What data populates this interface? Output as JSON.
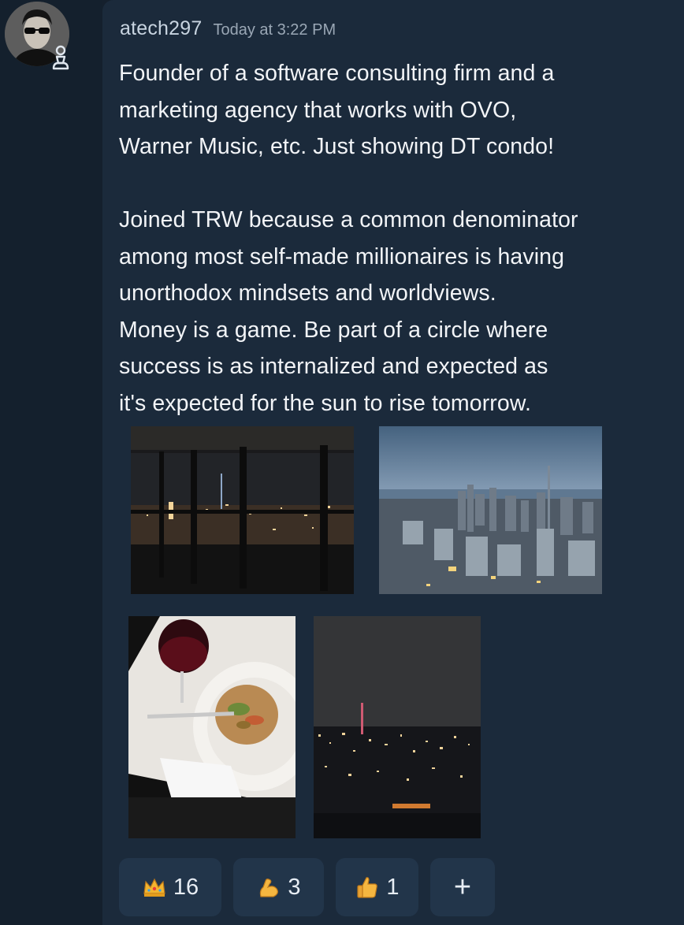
{
  "message": {
    "username": "atech297",
    "timestamp": "Today at 3:22 PM",
    "paragraphs": [
      [
        "Founder of a software consulting firm and a",
        "marketing agency that works with OVO,",
        "Warner Music, etc. Just showing DT condo!"
      ],
      [
        "Joined TRW because a common denominator",
        "among most self-made millionaires is having",
        "unorthodox mindsets and worldviews.",
        "Money is a game. Be part of a circle where",
        "success is as internalized and expected as",
        "it's expected for the sun to rise tomorrow."
      ]
    ]
  },
  "attachments": [
    {
      "name": "night-window-photo"
    },
    {
      "name": "city-skyline-photo"
    },
    {
      "name": "dinner-table-photo"
    },
    {
      "name": "night-tower-photo"
    }
  ],
  "reactions": [
    {
      "icon": "crown-icon",
      "count": "16"
    },
    {
      "icon": "flexed-biceps-icon",
      "count": "3"
    },
    {
      "icon": "thumbs-up-icon",
      "count": "1"
    }
  ],
  "add_reaction": {
    "label": "+"
  },
  "colors": {
    "background": "#15202d",
    "panel": "#1b2a3b",
    "reaction_chip": "#22354a",
    "username": "#c8d4e0",
    "timestamp": "#9aa7b5",
    "text": "#f2f4f7"
  }
}
